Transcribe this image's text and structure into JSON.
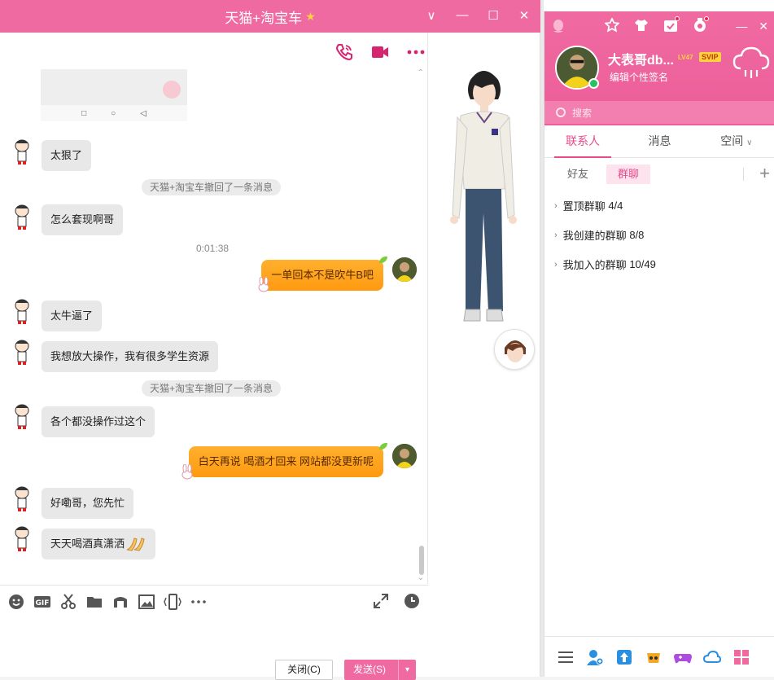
{
  "chat": {
    "title": "天猫+淘宝车",
    "window_buttons": {
      "dropdown": "∨",
      "minimize": "—",
      "maximize": "☐",
      "close": "✕"
    },
    "messages": [
      {
        "type": "in",
        "text": "太狠了"
      },
      {
        "type": "system",
        "text": "天猫+淘宝车撤回了一条消息"
      },
      {
        "type": "in",
        "text": "怎么套现啊哥"
      },
      {
        "type": "time",
        "text": "0:01:38"
      },
      {
        "type": "out",
        "text": "一单回本不是吹牛B吧"
      },
      {
        "type": "in",
        "text": "太牛逼了"
      },
      {
        "type": "in",
        "text": "我想放大操作，我有很多学生资源"
      },
      {
        "type": "system",
        "text": "天猫+淘宝车撤回了一条消息"
      },
      {
        "type": "in",
        "text": "各个都没操作过这个"
      },
      {
        "type": "out",
        "text": "白天再说  喝酒才回来 网站都没更新呢"
      },
      {
        "type": "in",
        "text": "好嘞哥，您先忙"
      },
      {
        "type": "in",
        "text": "天天喝酒真潇洒"
      }
    ],
    "close_button": "关闭(C)",
    "send_button": "发送(S)",
    "colors": {
      "accent": "#f06aa2",
      "bubble_out": "#ff9a10",
      "bubble_in": "#e8e8e8"
    }
  },
  "qq": {
    "profile": {
      "name": "大表哥db...",
      "level": "LV47",
      "vip": "SVIP",
      "signature": "编辑个性签名"
    },
    "search_placeholder": "搜索",
    "tabs": [
      "联系人",
      "消息",
      "空间"
    ],
    "subtabs": [
      "好友",
      "群聊"
    ],
    "groups": [
      {
        "label": "置顶群聊",
        "count": "4/4"
      },
      {
        "label": "我创建的群聊",
        "count": "8/8"
      },
      {
        "label": "我加入的群聊",
        "count": "10/49"
      }
    ],
    "window_buttons": {
      "minimize": "—",
      "close": "✕"
    }
  }
}
